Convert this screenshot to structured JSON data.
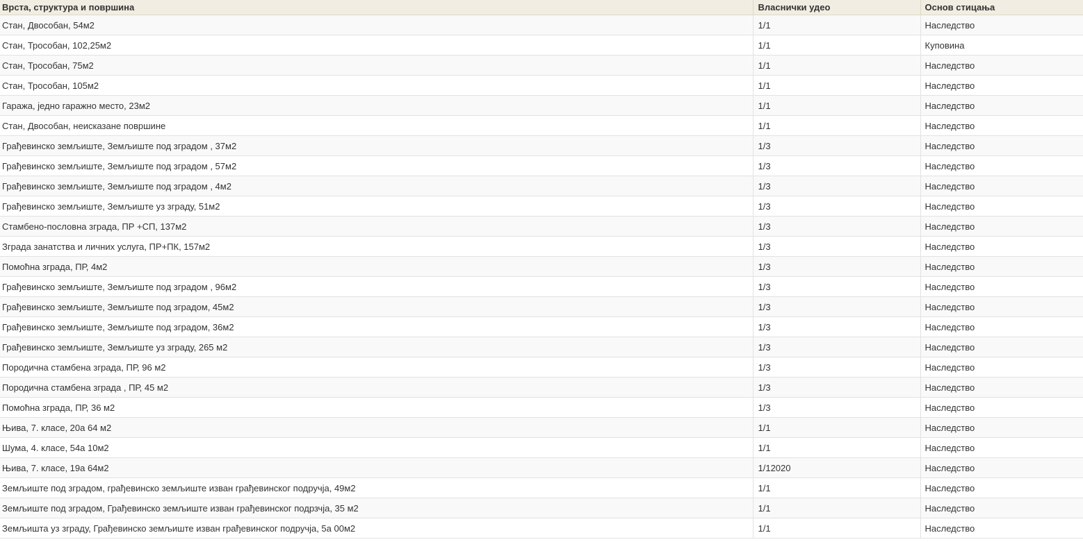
{
  "table": {
    "headers": {
      "type": "Врста, структура и површина",
      "share": "Власнички удео",
      "basis": "Основ стицања"
    },
    "rows": [
      {
        "type": "Стан, Двособан, 54м2",
        "share": "1/1",
        "basis": "Наследство"
      },
      {
        "type": "Стан, Трособан, 102,25м2",
        "share": "1/1",
        "basis": "Куповина"
      },
      {
        "type": "Стан, Трособан, 75м2",
        "share": "1/1",
        "basis": "Наследство"
      },
      {
        "type": "Стан, Трособан, 105м2",
        "share": "1/1",
        "basis": "Наследство"
      },
      {
        "type": "Гаража, једно гаражно место, 23м2",
        "share": "1/1",
        "basis": "Наследство"
      },
      {
        "type": "Стан, Двособан, неисказане површине",
        "share": "1/1",
        "basis": "Наследство"
      },
      {
        "type": "Грађевинско земљиште, Земљиште под зградом , 37м2",
        "share": "1/3",
        "basis": "Наследство"
      },
      {
        "type": "Грађевинско земљиште, Земљиште под зградом , 57м2",
        "share": "1/3",
        "basis": "Наследство"
      },
      {
        "type": "Грађевинско земљиште, Земљиште под зградом , 4м2",
        "share": "1/3",
        "basis": "Наследство"
      },
      {
        "type": "Грађевинско земљиште, Земљиште уз зграду, 51м2",
        "share": "1/3",
        "basis": "Наследство"
      },
      {
        "type": "Стамбено-пословна зграда, ПР +СП, 137м2",
        "share": "1/3",
        "basis": "Наследство"
      },
      {
        "type": "Зграда занатства и личних услуга, ПР+ПК, 157м2",
        "share": "1/3",
        "basis": "Наследство"
      },
      {
        "type": "Помоћна зграда, ПР, 4м2",
        "share": "1/3",
        "basis": "Наследство"
      },
      {
        "type": "Грађевинско земљиште, Земљиште под зградом , 96м2",
        "share": "1/3",
        "basis": "Наследство"
      },
      {
        "type": "Грађевинско земљиште, Земљиште под зградом, 45м2",
        "share": "1/3",
        "basis": "Наследство"
      },
      {
        "type": "Грађевинско земљиште, Земљиште под зградом, 36м2",
        "share": "1/3",
        "basis": "Наследство"
      },
      {
        "type": "Грађевинско земљиште, Земљиште уз зграду, 265 м2",
        "share": "1/3",
        "basis": "Наследство"
      },
      {
        "type": "Породична стамбена зграда, ПР, 96 м2",
        "share": "1/3",
        "basis": "Наследство"
      },
      {
        "type": "Породична стамбена зграда , ПР, 45 м2",
        "share": "1/3",
        "basis": "Наследство"
      },
      {
        "type": "Помоћна зграда, ПР, 36 м2",
        "share": "1/3",
        "basis": "Наследство"
      },
      {
        "type": "Њива, 7. класе, 20а 64 м2",
        "share": "1/1",
        "basis": "Наследство"
      },
      {
        "type": "Шума, 4. класе, 54а 10м2",
        "share": "1/1",
        "basis": "Наследство"
      },
      {
        "type": "Њива, 7. класе, 19а 64м2",
        "share": "1/12020",
        "basis": "Наследство"
      },
      {
        "type": "Земљиште под зградом, грађевинско земљиште изван грађевинског подручја, 49м2",
        "share": "1/1",
        "basis": "Наследство"
      },
      {
        "type": "Земљиште под зградом, Грађевинско земљиште изван грађевинског подрзчја, 35 м2",
        "share": "1/1",
        "basis": "Наследство"
      },
      {
        "type": "Земљишта уз зграду, Грађевинско земљиште изван грађевинског подручја, 5а 00м2",
        "share": "1/1",
        "basis": "Наследство"
      }
    ]
  }
}
